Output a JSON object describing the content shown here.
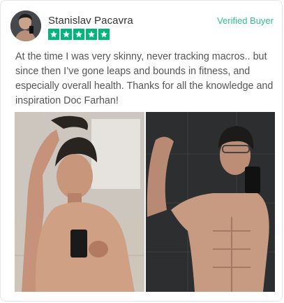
{
  "review": {
    "author": "Stanislav Pacavra",
    "badge": "Verified Buyer",
    "rating": 5,
    "text": "At the time I was very skinny, never tracking macros.. but since then I’ve gone leaps and bounds in fitness, and especially overall health. Thanks for all the knowledge and inspiration Doc Farhan!"
  },
  "colors": {
    "star_bg": "#00b67a",
    "badge": "#2fbf8f"
  },
  "icons": {
    "star": "star-icon",
    "avatar": "user-avatar"
  },
  "images": {
    "before": "before-photo",
    "after": "after-photo"
  }
}
